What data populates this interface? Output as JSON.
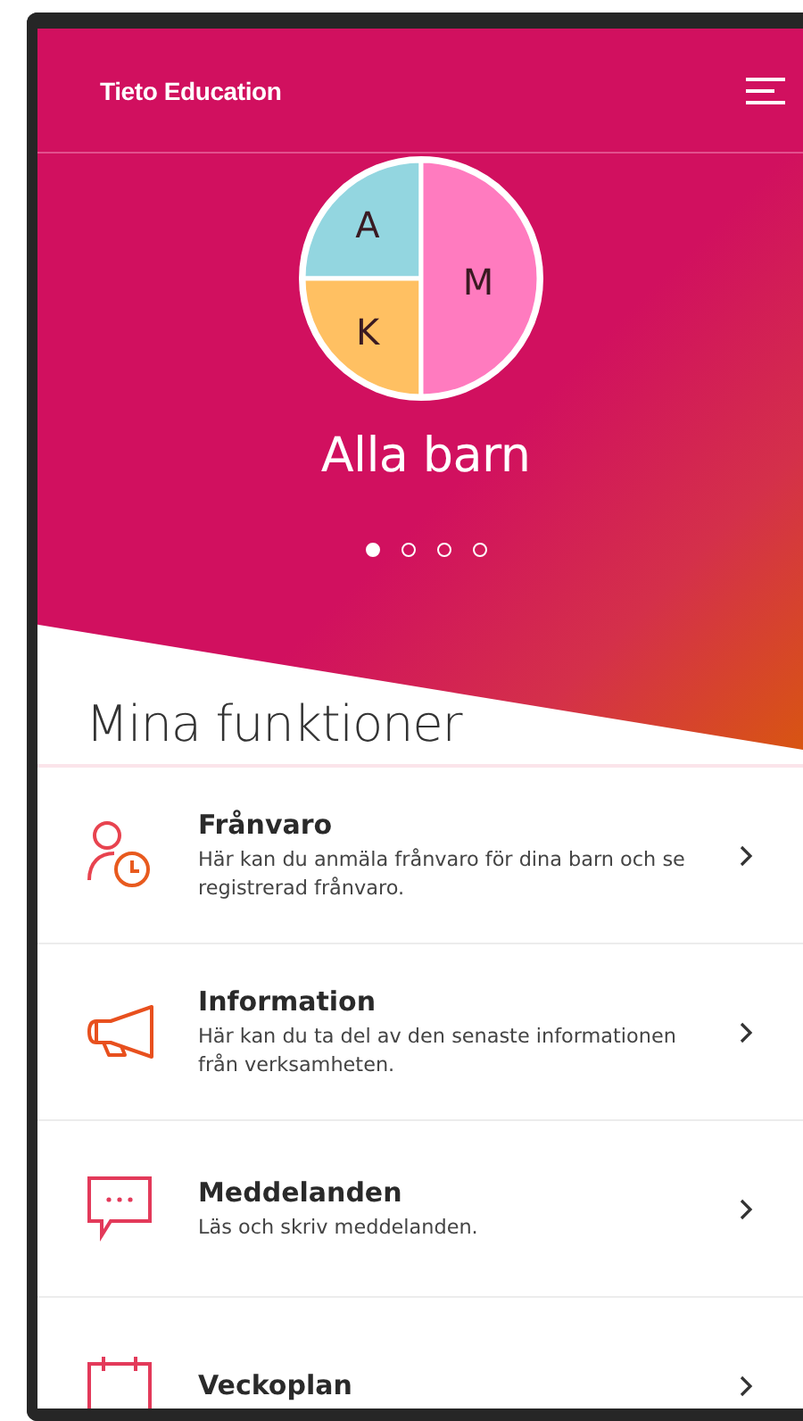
{
  "header": {
    "brand": "Tieto Education"
  },
  "hero": {
    "children": [
      {
        "initial": "A",
        "color": "#93d6e0",
        "kind": "top-left"
      },
      {
        "initial": "K",
        "color": "#ffc062",
        "kind": "bottom-left"
      },
      {
        "initial": "M",
        "color": "#ff7bbf",
        "kind": "right-half"
      }
    ],
    "title": "Alla barn",
    "pager": [
      {
        "selected": true
      },
      {
        "selected": false
      },
      {
        "selected": false
      },
      {
        "selected": false
      }
    ]
  },
  "section_title": "Mina funktioner",
  "functions": [
    {
      "kind": "absence",
      "title": "Frånvaro",
      "description": "Här kan du anmäla frånvaro för dina barn och se registrerad frånvaro."
    },
    {
      "kind": "information",
      "title": "Information",
      "description": "Här kan du ta del av den senaste informationen från verksamheten."
    },
    {
      "kind": "messages",
      "title": "Meddelanden",
      "description": "Läs och skriv meddelanden."
    },
    {
      "kind": "calendar",
      "title": "Veckoplan"
    }
  ]
}
